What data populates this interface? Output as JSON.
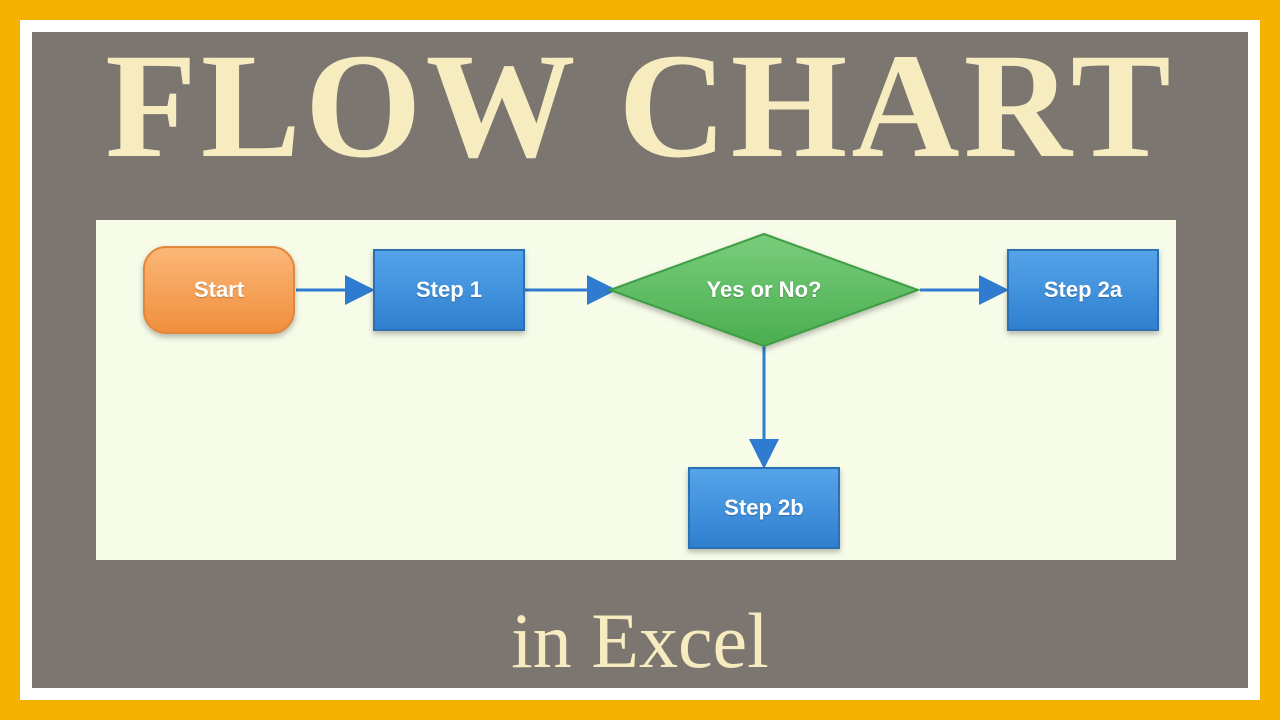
{
  "title": "FLOW CHART",
  "subtitle": "in Excel",
  "flowchart": {
    "nodes": {
      "start": {
        "label": "Start",
        "type": "terminator"
      },
      "step1": {
        "label": "Step 1",
        "type": "process"
      },
      "decision": {
        "label": "Yes or No?",
        "type": "decision"
      },
      "step2a": {
        "label": "Step 2a",
        "type": "process"
      },
      "step2b": {
        "label": "Step 2b",
        "type": "process"
      }
    },
    "edges": [
      {
        "from": "start",
        "to": "step1"
      },
      {
        "from": "step1",
        "to": "decision"
      },
      {
        "from": "decision",
        "to": "step2a"
      },
      {
        "from": "decision",
        "to": "step2b"
      }
    ]
  },
  "colors": {
    "frame": "#f3b200",
    "panel": "#7c7670",
    "canvas": "#f7fce9",
    "title": "#f7ecc0",
    "terminator_fill": "#f7a45a",
    "terminator_stroke": "#e2873b",
    "process_fill": "#3f90db",
    "process_stroke": "#2b6fb3",
    "decision_fill": "#5fbb63",
    "decision_stroke": "#3f9d44",
    "arrow": "#2f7bd0"
  }
}
